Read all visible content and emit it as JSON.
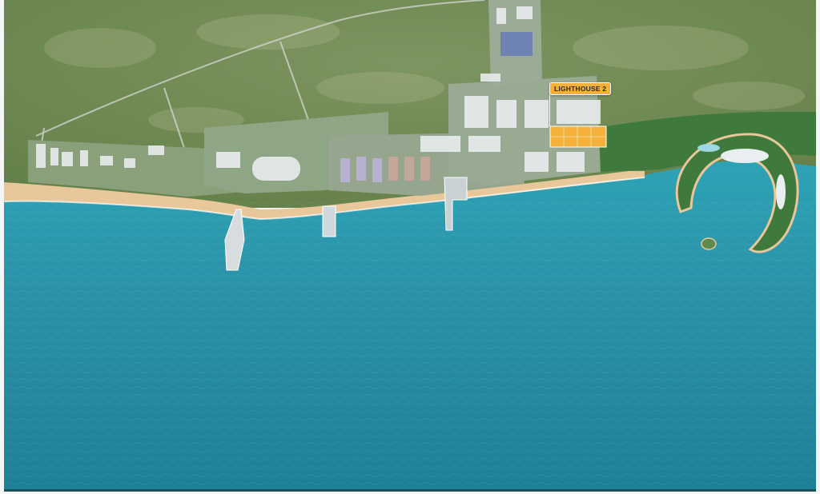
{
  "map": {
    "callout_label": "LIGHTHOUSE 2",
    "colors": {
      "sea": "#2a93a8",
      "sea_deep": "#1f7f94",
      "land": "#6f8a52",
      "beach": "#e8c79a",
      "highlight_plot": "#f3b13c"
    }
  }
}
